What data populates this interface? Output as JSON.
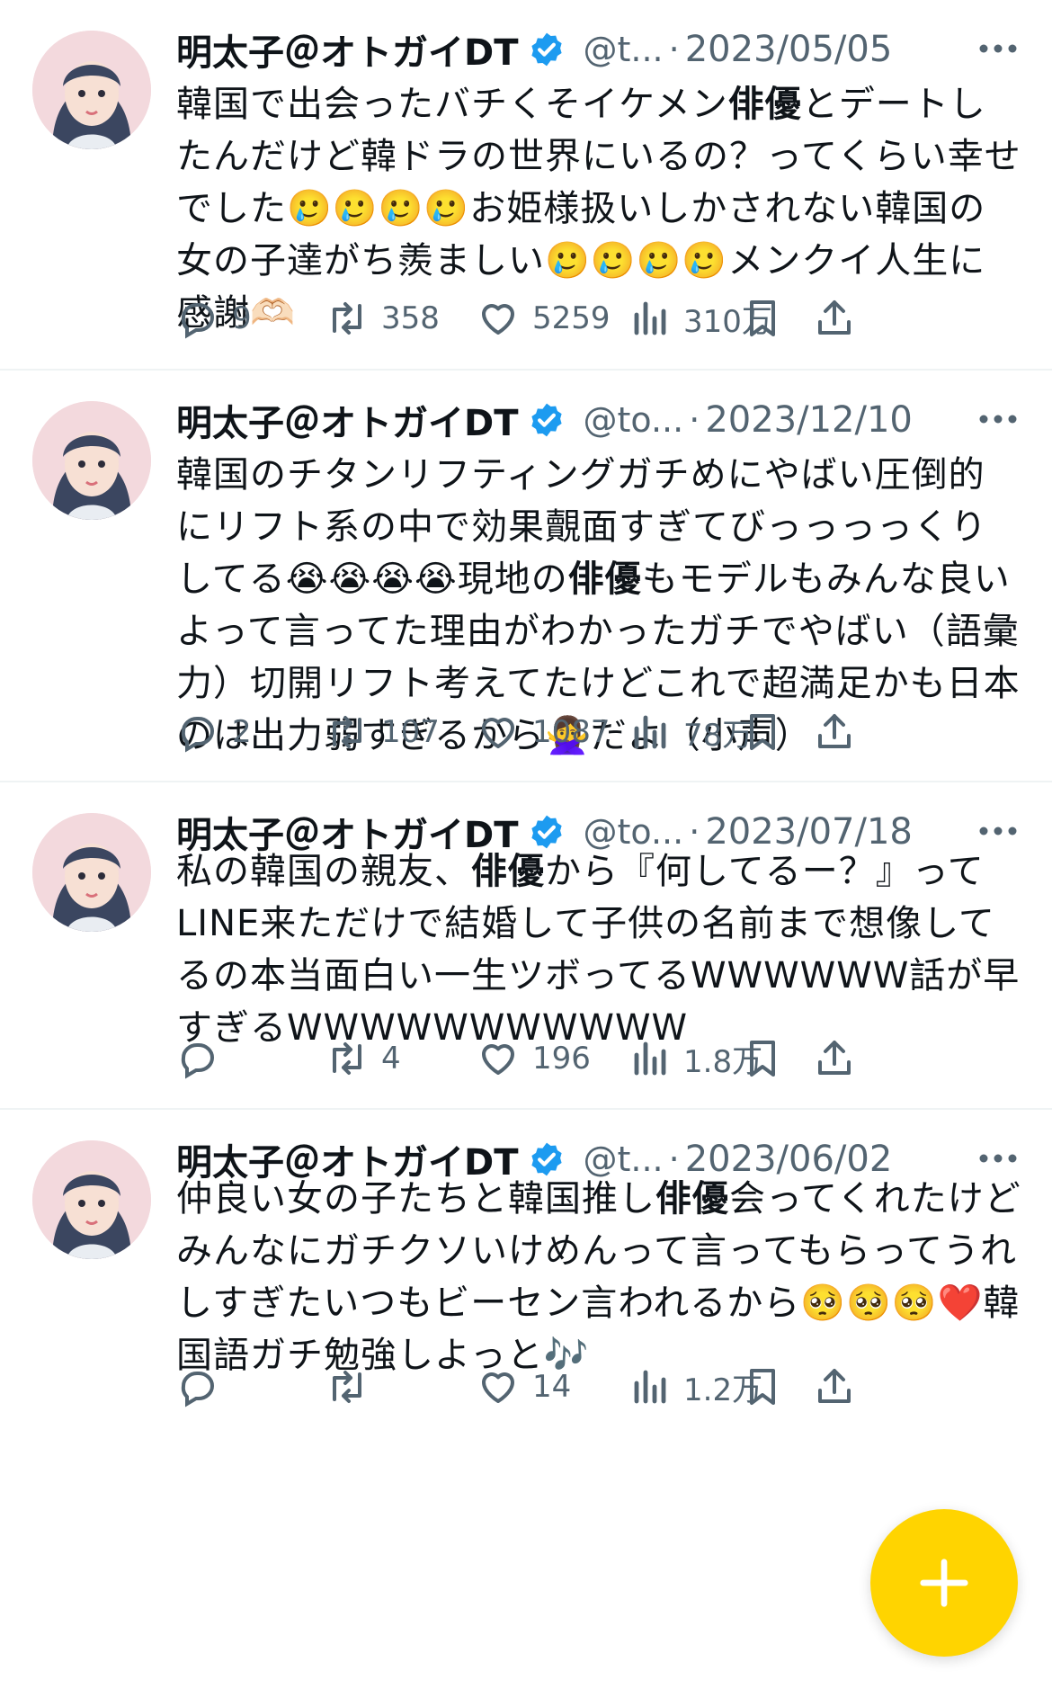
{
  "tweets": [
    {
      "name": "明太子＠オトガイDT",
      "handle": "@t...",
      "date": "2023/05/05",
      "text_before": "韓国で出会ったバチくそイケメン",
      "text_bold": "俳優",
      "text_after": "とデートしたんだけど韓ドラの世界にいるの？ってくらい幸せでした🥲🥲🥲🥲お姫様扱いしかされない韓国の女の子達がち羨ましい🥲🥲🥲🥲メンクイ人生に感謝🫶🏻",
      "replies": "9",
      "retweets": "358",
      "likes": "5259",
      "views": "310万"
    },
    {
      "name": "明太子＠オトガイDT",
      "handle": "@to...",
      "date": "2023/12/10",
      "text_before": "韓国のチタンリフティングガチめにやばい圧倒的にリフト系の中で効果覿面すぎてびっっっっくりしてる😭😭😭😭現地の",
      "text_bold": "俳優",
      "text_after": "もモデルもみんな良いよって言ってた理由がわかったガチでやばい（語彙力）切開リフト考えてたけどこれで超満足かも日本のは出力弱すぎるから🙅‍♀️だよ（小声）",
      "replies": "2",
      "retweets": "107",
      "likes": "1087",
      "views": "78万"
    },
    {
      "name": "明太子＠オトガイDT",
      "handle": "@to...",
      "date": "2023/07/18",
      "text_before": "私の韓国の親友、",
      "text_bold": "俳優",
      "text_after": "から『何してるー？』ってLINE来ただけで結婚して子供の名前まで想像してるの本当面白い一生ツボってるWWWWWW話が早すぎるWWWWWWWWWWW",
      "replies": "",
      "retweets": "4",
      "likes": "196",
      "views": "1.8万"
    },
    {
      "name": "明太子＠オトガイDT",
      "handle": "@t...",
      "date": "2023/06/02",
      "text_before": "仲良い女の子たちと韓国推し",
      "text_bold": "俳優",
      "text_after": "会ってくれたけどみんなにガチクソいけめんって言ってもらってうれしすぎたいつもビーセン言われるから🥺🥺🥺❤️韓国語ガチ勉強しよっと🎶",
      "replies": "",
      "retweets": "",
      "likes": "14",
      "views": "1.2万"
    }
  ],
  "colors": {
    "verified": "#1d9bf0",
    "muted": "#536471",
    "fab": "#ffd400",
    "divider": "#eff3f4"
  },
  "icons": {
    "reply": "speech-bubble-icon",
    "retweet": "retweet-arrows-icon",
    "like": "heart-icon",
    "views": "bar-chart-icon",
    "bookmark": "bookmark-icon",
    "share": "share-upload-icon",
    "more": "more-dots-icon",
    "verified": "verified-badge-icon",
    "fab": "plus-icon"
  }
}
